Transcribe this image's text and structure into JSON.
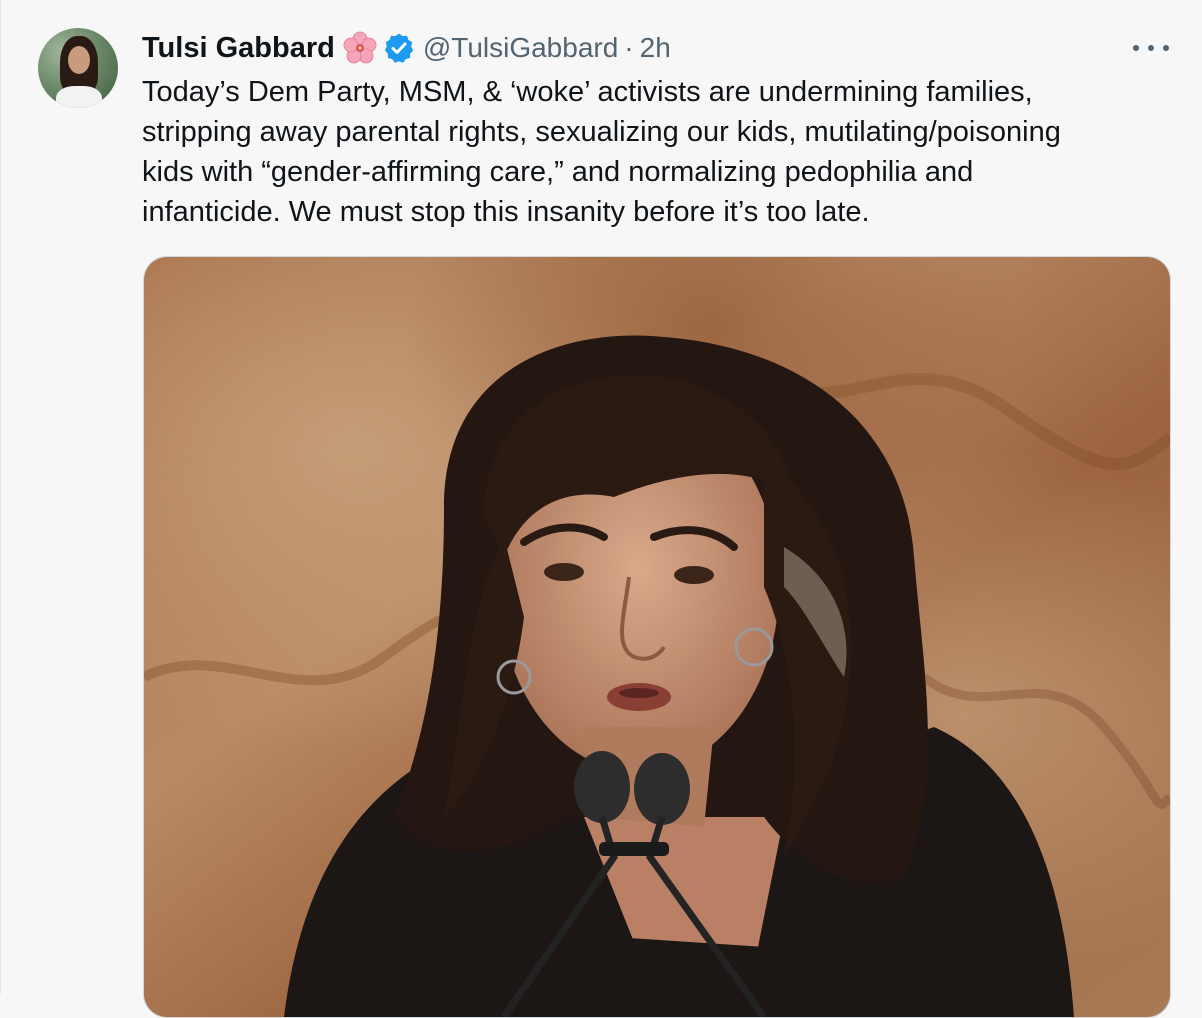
{
  "tweet": {
    "author": {
      "display_name": "Tulsi Gabbard",
      "handle": "@TulsiGabbard",
      "avatar_icon": "profile-photo",
      "emoji_icon": "hibiscus-icon",
      "verified_icon": "verified-badge-icon"
    },
    "separator": "·",
    "timestamp": "2h",
    "text_lines": [
      "Today’s Dem Party, MSM, & ‘woke’ activists are undermining families,",
      "stripping away parental rights, sexualizing our kids, mutilating/poisoning",
      "kids with “gender-affirming care,” and normalizing pedophilia and",
      "infanticide. We must stop this insanity before it’s too late."
    ],
    "menu_icon": "more-options-icon"
  },
  "colors": {
    "text_primary": "#0f1419",
    "text_secondary": "#536471",
    "verified_blue": "#1d9bf0",
    "background": "#f7f7f7"
  }
}
